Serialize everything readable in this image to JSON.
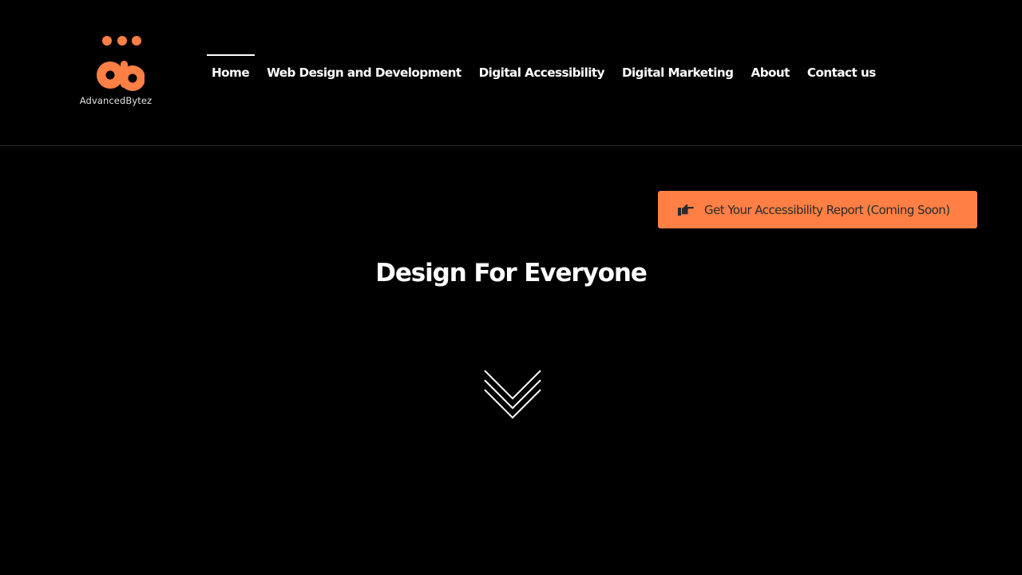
{
  "brand": {
    "name": "AdvancedBytez",
    "accent_color": "#ff7f45"
  },
  "nav": {
    "items": [
      {
        "label": "Home",
        "active": true
      },
      {
        "label": "Web Design and Development"
      },
      {
        "label": "Digital Accessibility"
      },
      {
        "label": "Digital Marketing"
      },
      {
        "label": "About"
      },
      {
        "label": "Contact us"
      }
    ]
  },
  "cta": {
    "label": "Get Your Accessibility Report (Coming Soon)",
    "icon": "hand-pointing-right-icon"
  },
  "hero": {
    "title": "Design For Everyone",
    "scroll_icon": "chevrons-down-icon"
  }
}
